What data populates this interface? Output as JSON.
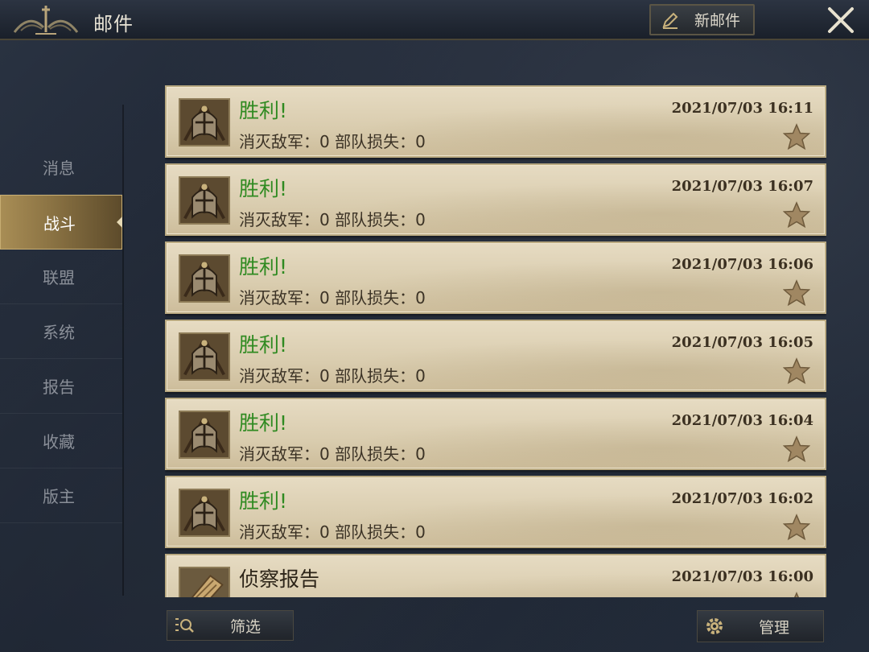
{
  "header": {
    "title": "邮件",
    "new_mail_label": "新邮件"
  },
  "sidebar": {
    "items": [
      {
        "label": "消息",
        "active": false
      },
      {
        "label": "战斗",
        "active": true
      },
      {
        "label": "联盟",
        "active": false
      },
      {
        "label": "系统",
        "active": false
      },
      {
        "label": "报告",
        "active": false
      },
      {
        "label": "收藏",
        "active": false
      },
      {
        "label": "版主",
        "active": false
      }
    ]
  },
  "mails": [
    {
      "headline": "胜利!",
      "detail": "消灭敌军：0 部队损失：0",
      "time": "2021/07/03 16:11",
      "type": "battle"
    },
    {
      "headline": "胜利!",
      "detail": "消灭敌军：0 部队损失：0",
      "time": "2021/07/03 16:07",
      "type": "battle"
    },
    {
      "headline": "胜利!",
      "detail": "消灭敌军：0 部队损失：0",
      "time": "2021/07/03 16:06",
      "type": "battle"
    },
    {
      "headline": "胜利!",
      "detail": "消灭敌军：0 部队损失：0",
      "time": "2021/07/03 16:05",
      "type": "battle"
    },
    {
      "headline": "胜利!",
      "detail": "消灭敌军：0 部队损失：0",
      "time": "2021/07/03 16:04",
      "type": "battle"
    },
    {
      "headline": "胜利!",
      "detail": "消灭敌军：0 部队损失：0",
      "time": "2021/07/03 16:02",
      "type": "battle"
    },
    {
      "headline": "侦察报告",
      "detail": "",
      "time": "2021/07/03 16:00",
      "type": "scout"
    }
  ],
  "footer": {
    "filter_label": "筛选",
    "manage_label": "管理"
  },
  "colors": {
    "victory_green": "#2f8a21",
    "sidebar_active": "#a88d55",
    "card_bg": "#e6dbc2"
  },
  "icons": {
    "emblem": "crest-icon",
    "pen": "pencil-icon",
    "close": "close-icon",
    "star": "star-icon",
    "filter": "filter-icon",
    "gear": "gear-icon",
    "helmet": "helmet-icon",
    "scroll": "scroll-icon"
  }
}
